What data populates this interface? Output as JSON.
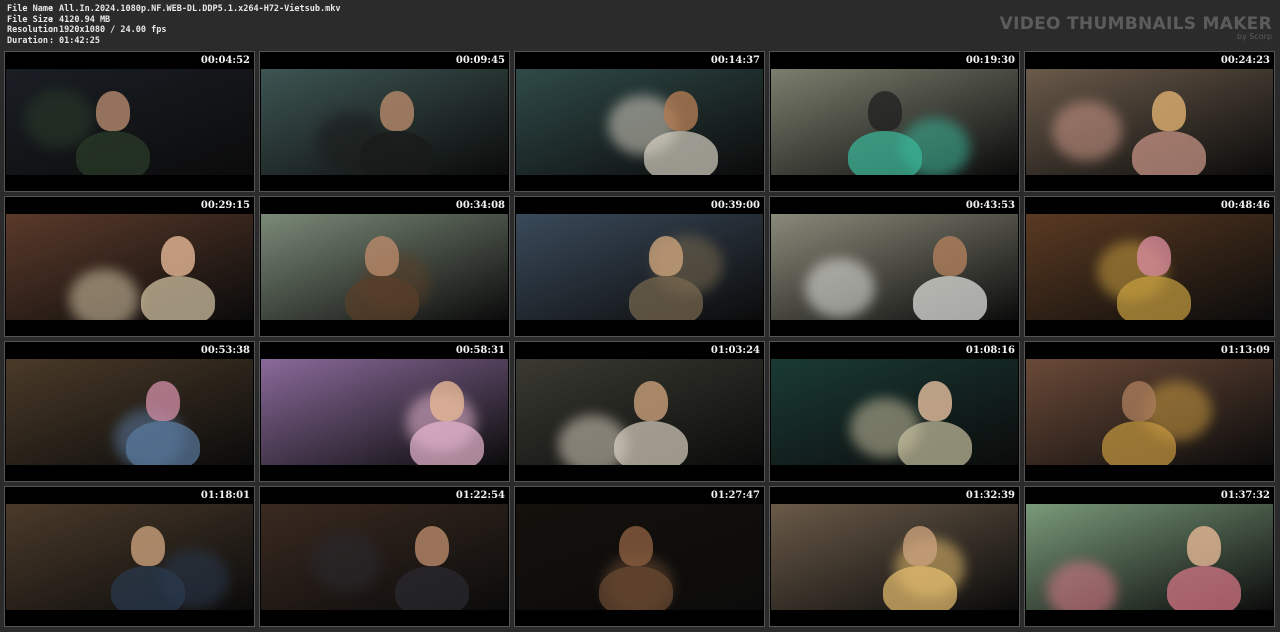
{
  "file_info": {
    "rows": [
      {
        "key": "File Name",
        "sep": ":",
        "value": "All.In.2024.1080p.NF.WEB-DL.DDP5.1.x264-H72-Vietsub.mkv"
      },
      {
        "key": "File Size",
        "sep": ":",
        "value": "4120.94 MB"
      },
      {
        "key": "Resolution",
        "sep": ":",
        "value": "1920x1080 / 24.00 fps"
      },
      {
        "key": "Duration",
        "sep": ":",
        "value": "01:42:25"
      }
    ]
  },
  "branding": {
    "title": "VIDEO THUMBNAILS MAKER",
    "subtitle": "by Scorp"
  },
  "thumbnails": [
    {
      "time": "00:04:52",
      "bg": "#1a1e24",
      "accent": "#2b3d2a",
      "skin": "#b58a6e"
    },
    {
      "time": "00:09:45",
      "bg": "#3d5552",
      "accent": "#1a1a1a",
      "skin": "#b88a6c"
    },
    {
      "time": "00:14:37",
      "bg": "#2f4a48",
      "accent": "#d6d0c2",
      "skin": "#b07a52"
    },
    {
      "time": "00:19:30",
      "bg": "#7c7f6e",
      "accent": "#3bb99b",
      "skin": "#222222"
    },
    {
      "time": "00:24:23",
      "bg": "#6a5a4a",
      "accent": "#cf9a8a",
      "skin": "#e0b070"
    },
    {
      "time": "00:29:15",
      "bg": "#5a3a2a",
      "accent": "#d8c9a8",
      "skin": "#e6b896"
    },
    {
      "time": "00:34:08",
      "bg": "#7b8a78",
      "accent": "#5a3f28",
      "skin": "#b98a6a"
    },
    {
      "time": "00:39:00",
      "bg": "#3a4a5a",
      "accent": "#7a6a50",
      "skin": "#caa27a"
    },
    {
      "time": "00:43:53",
      "bg": "#8a8a7a",
      "accent": "#e8e8e4",
      "skin": "#b0805c"
    },
    {
      "time": "00:48:46",
      "bg": "#5a3a22",
      "accent": "#c8a040",
      "skin": "#d68a9a"
    },
    {
      "time": "00:53:38",
      "bg": "#4a3a28",
      "accent": "#5a7aa0",
      "skin": "#c98aa0"
    },
    {
      "time": "00:58:31",
      "bg": "#8a6a9a",
      "accent": "#e8b8d0",
      "skin": "#e6b896"
    },
    {
      "time": "01:03:24",
      "bg": "#3a3a32",
      "accent": "#d8d0c0",
      "skin": "#c9a07a"
    },
    {
      "time": "01:08:16",
      "bg": "#1a3a34",
      "accent": "#c8c0a0",
      "skin": "#e6c0a0"
    },
    {
      "time": "01:13:09",
      "bg": "#6a4a38",
      "accent": "#c89a40",
      "skin": "#a87a5a"
    },
    {
      "time": "01:18:01",
      "bg": "#4a3a2a",
      "accent": "#2a3a50",
      "skin": "#c9a07a"
    },
    {
      "time": "01:22:54",
      "bg": "#3a2a20",
      "accent": "#2a2a30",
      "skin": "#b98a6a"
    },
    {
      "time": "01:27:47",
      "bg": "#14100c",
      "accent": "#6a4a32",
      "skin": "#8a5e40"
    },
    {
      "time": "01:32:39",
      "bg": "#6a5a48",
      "accent": "#e8c070",
      "skin": "#c9a07a"
    },
    {
      "time": "01:37:32",
      "bg": "#7a9a7a",
      "accent": "#e07a8a",
      "skin": "#e6b896"
    }
  ]
}
